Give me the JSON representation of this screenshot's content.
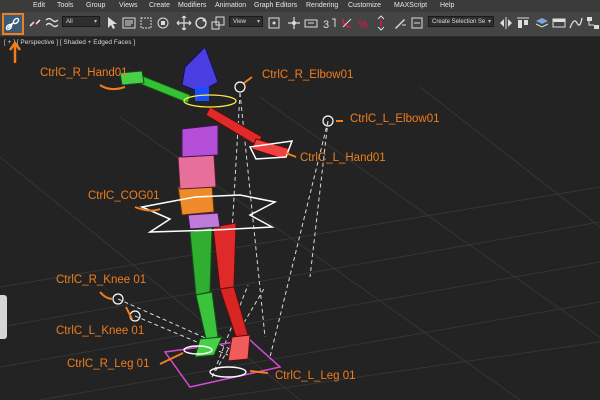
{
  "menu": {
    "items": [
      "Edit",
      "Tools",
      "Group",
      "Views",
      "Create",
      "Modifiers",
      "Animation",
      "Graph Editors",
      "Rendering",
      "Customize",
      "MAXScript",
      "Help"
    ]
  },
  "toolbar": {
    "filter_dropdown": "All",
    "coord_dropdown": "View",
    "selection_set_placeholder": "Create Selection Se"
  },
  "viewport": {
    "label": "[ + ] [ Perspective ] [ Shaded + Edged Faces ]"
  },
  "callouts": {
    "r_hand": "CtrlC_R_Hand01",
    "r_elbow": "CtrlC_R_Elbow01",
    "l_elbow": "CtrlC_L_Elbow01",
    "l_hand": "CtrlC_L_Hand01",
    "cog": "CtrlC_COG01",
    "r_knee": "CtrlC_R_Knee 01",
    "l_knee": "CtrlC_L_Knee 01",
    "r_leg": "CtrlC_R_Leg 01",
    "l_leg": "CtrlC_L_Leg 01"
  },
  "colors": {
    "accent_orange": "#f07d1e",
    "viewport_bg": "#232323",
    "grid": "#3a3a3a"
  }
}
